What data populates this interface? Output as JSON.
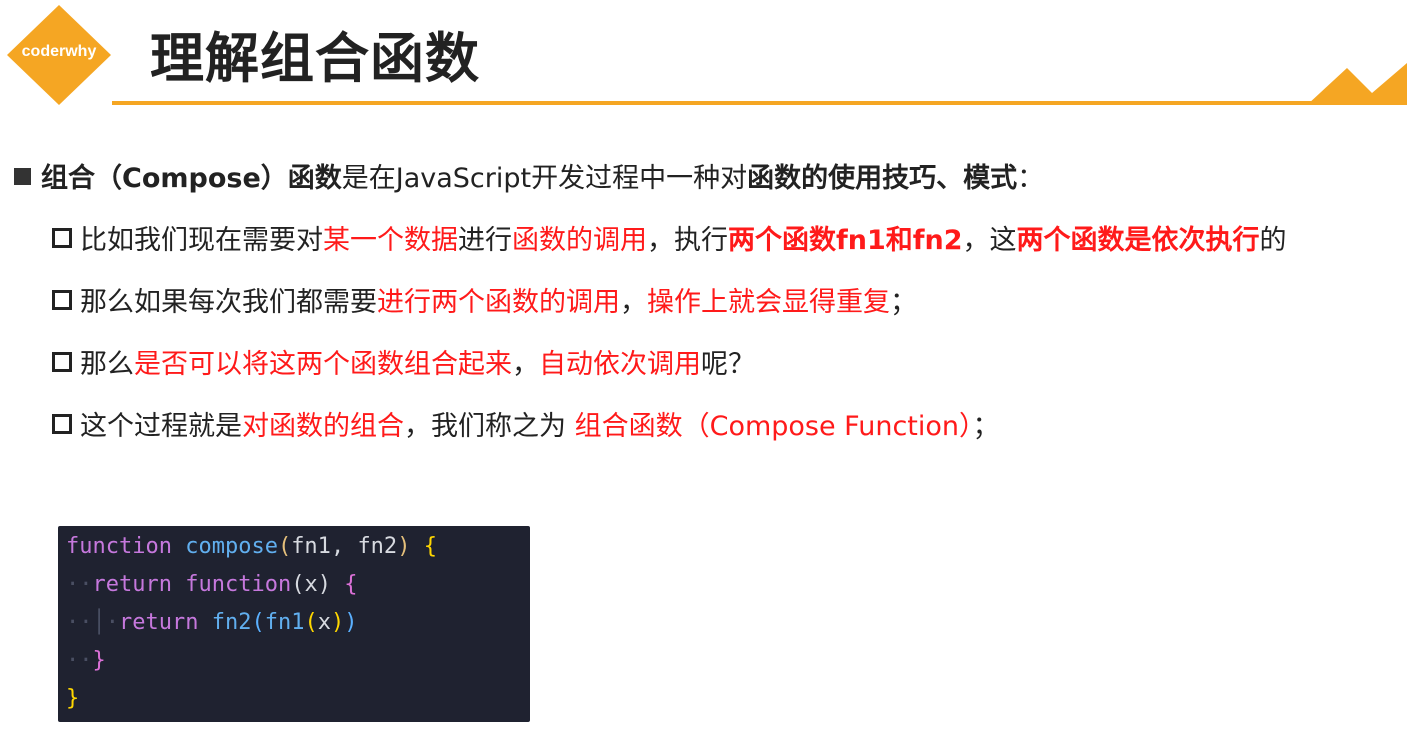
{
  "logo": {
    "text": "coderwhy"
  },
  "title": "理解组合函数",
  "colors": {
    "accent": "#f5a623",
    "highlight": "#ff1a1a",
    "code_bg": "#1f2230"
  },
  "main_point": {
    "t1": "组合（Compose）函数",
    "t2": "是在JavaScript开发过程中一种对",
    "t3": "函数的使用技巧、模式",
    "t4": "："
  },
  "sub_points": [
    {
      "p1": "比如我们现在需要对",
      "p2": "某一个数据",
      "p3": "进行",
      "p4": "函数的调用",
      "p5": "，执行",
      "p6": "两个函数fn1和fn2",
      "p7": "，这",
      "p8": "两个函数是依次执行",
      "p9": "的"
    },
    {
      "p1": "那么如果每次我们都需要",
      "p2": "进行两个函数的调用",
      "p3": "，",
      "p4": "操作上就会显得重复",
      "p5": "；"
    },
    {
      "p1": "那么",
      "p2": "是否可以将这两个函数组合起来",
      "p3": "，",
      "p4": "自动依次调用",
      "p5": "呢？"
    },
    {
      "p1": "这个过程就是",
      "p2": "对函数的组合",
      "p3": "，我们称之为 ",
      "p4": "组合函数（Compose Function）",
      "p5": "；"
    }
  ],
  "code": {
    "l1_kw": "function",
    "l1_fn": "compose",
    "l1_p1": "fn1",
    "l1_p2": "fn2",
    "l2_kw": "return",
    "l2_fn": "function",
    "l2_p": "x",
    "l3_kw": "return",
    "l3_fn1": "fn2",
    "l3_fn2": "fn1",
    "l3_p": "x"
  }
}
